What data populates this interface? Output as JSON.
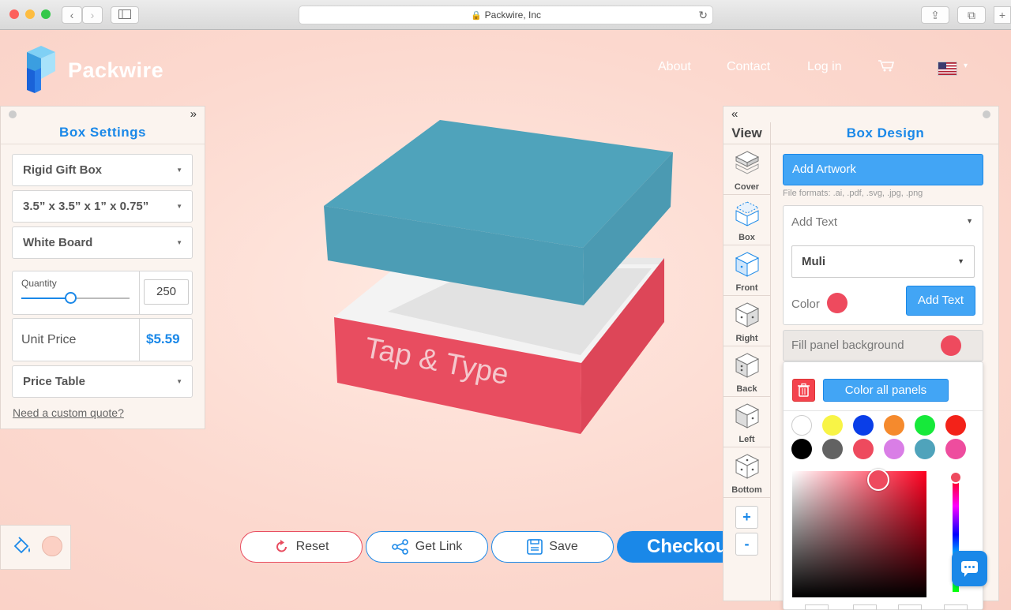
{
  "browser": {
    "url_text": "Packwire, Inc"
  },
  "brand": {
    "name": "Packwire",
    "accent": "#1a88e8",
    "primary_red": "#ee4a5e",
    "lid_color": "#4fa3bb"
  },
  "nav": {
    "items": [
      "About",
      "Contact",
      "Log in"
    ]
  },
  "box_settings": {
    "title": "Box Settings",
    "box_type": "Rigid Gift Box",
    "dimensions": "3.5” x 3.5” x 1” x 0.75”",
    "material": "White Board",
    "quantity_label": "Quantity",
    "quantity": "250",
    "quantity_slider_fraction": 0.45,
    "unit_price_label": "Unit Price",
    "unit_price": "$5.59",
    "price_table": "Price Table",
    "custom_quote": "Need a custom quote?"
  },
  "canvas": {
    "box_text": "Tap & Type"
  },
  "toolbar": {
    "reset": "Reset",
    "get_link": "Get Link",
    "save": "Save",
    "checkout": "Checkout"
  },
  "view": {
    "title": "View",
    "items": [
      "Cover",
      "Box",
      "Front",
      "Right",
      "Back",
      "Left",
      "Bottom"
    ],
    "zoom_in": "+",
    "zoom_out": "-"
  },
  "box_design": {
    "title": "Box Design",
    "add_artwork": "Add Artwork",
    "file_formats": "File formats: .ai, .pdf, .svg, .jpg, .png",
    "add_text_label": "Add Text",
    "font": "Muli",
    "color_label": "Color",
    "add_text_button": "Add Text",
    "fill_panel_background": "Fill panel background",
    "color_all_panels": "Color all panels",
    "swatches": [
      "#ffffff",
      "#f8f446",
      "#0a3ee8",
      "#f58a2d",
      "#16e93a",
      "#f32219",
      "#000000",
      "#626262",
      "#ee4a5e",
      "#d97ee6",
      "#4fa3bb",
      "#ee4d9e"
    ]
  }
}
